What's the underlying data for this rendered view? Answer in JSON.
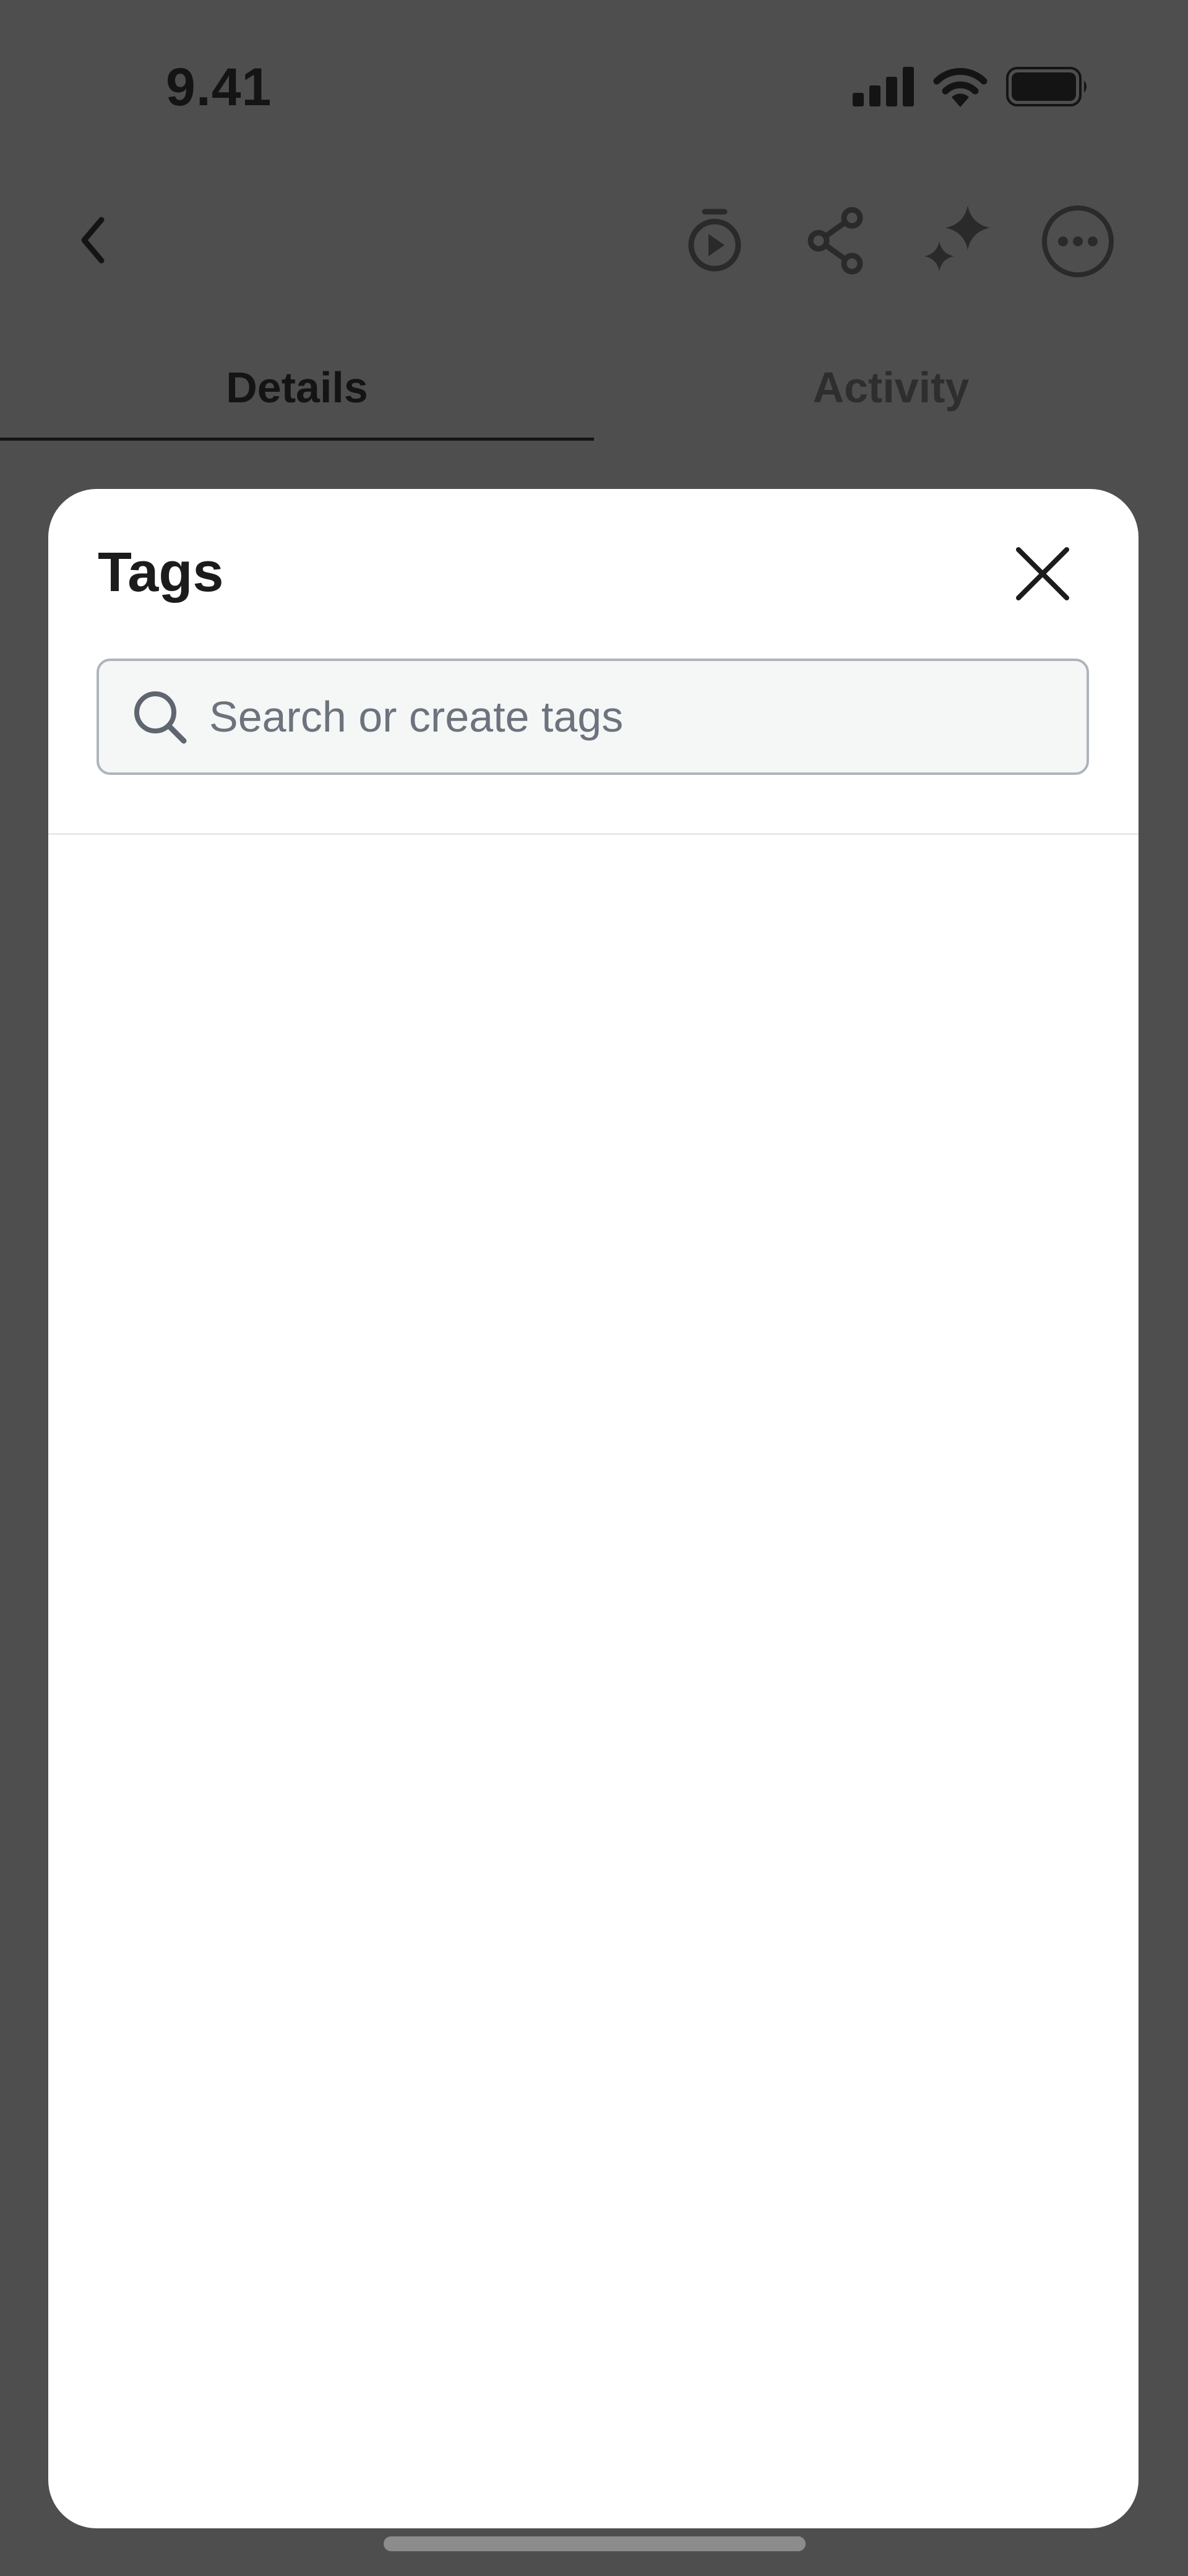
{
  "status_bar": {
    "time": "9.41",
    "icons": [
      "cellular-signal-icon",
      "wifi-icon",
      "battery-icon"
    ]
  },
  "nav_bar": {
    "icons": [
      "chevron-left-icon",
      "timer-play-icon",
      "share-icon",
      "sparkle-icon",
      "more-icon"
    ]
  },
  "tabs": [
    {
      "label": "Details",
      "active": true
    },
    {
      "label": "Activity",
      "active": false
    }
  ],
  "tags_sheet": {
    "title": "Tags",
    "search": {
      "placeholder": "Search or create tags",
      "value": ""
    },
    "tags": []
  },
  "colors": {
    "overlay_background": "#4e4e4e",
    "sheet_background": "#ffffff",
    "text_primary": "#1c1c1c",
    "search_border": "#aeb4bc",
    "search_background": "#f5f7f7",
    "placeholder": "#6c737d"
  }
}
